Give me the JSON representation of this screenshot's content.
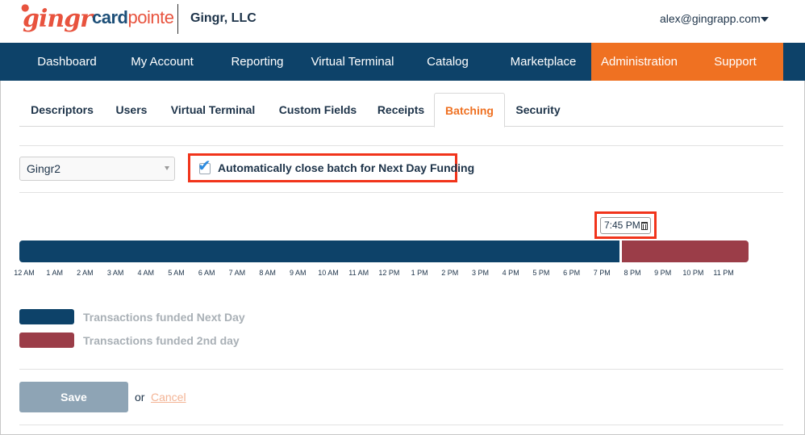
{
  "header": {
    "logo_gingr": "gingr",
    "logo_card": "card",
    "logo_pointe": "pointe",
    "company": "Gingr, LLC",
    "account_email": "alex@gingrapp.com"
  },
  "nav": {
    "items": [
      {
        "label": "Dashboard"
      },
      {
        "label": "My Account"
      },
      {
        "label": "Reporting"
      },
      {
        "label": "Virtual Terminal"
      },
      {
        "label": "Catalog"
      },
      {
        "label": "Marketplace"
      },
      {
        "label": "Administration"
      },
      {
        "label": "Support"
      }
    ],
    "highlight_color": "#ef7122",
    "bg_color": "#0d4269"
  },
  "tabs": {
    "items": [
      {
        "label": "Descriptors"
      },
      {
        "label": "Users"
      },
      {
        "label": "Virtual Terminal"
      },
      {
        "label": "Custom Fields"
      },
      {
        "label": "Receipts"
      },
      {
        "label": "Batching"
      },
      {
        "label": "Security"
      }
    ],
    "active": "Batching"
  },
  "controls": {
    "merchant_select_value": "Gingr2",
    "auto_close_label": "Automatically close batch for Next Day Funding",
    "auto_close_checked": true
  },
  "timeline": {
    "cutoff_time": "7:45 PM",
    "ticks": [
      "12 AM",
      "1 AM",
      "2 AM",
      "3 AM",
      "4 AM",
      "5 AM",
      "6 AM",
      "7 AM",
      "8 AM",
      "9 AM",
      "10 AM",
      "11 AM",
      "12 PM",
      "1 PM",
      "2 PM",
      "3 PM",
      "4 PM",
      "5 PM",
      "6 PM",
      "7 PM",
      "8 PM",
      "9 PM",
      "10 PM",
      "11 PM"
    ],
    "next_day_color": "#0d4269",
    "second_day_color": "#9b3d48"
  },
  "legend": {
    "next_day_label": "Transactions funded Next Day",
    "second_day_label": "Transactions funded 2nd day"
  },
  "actions": {
    "save_label": "Save",
    "or_text": "or",
    "cancel_label": "Cancel"
  },
  "icons": {
    "checkmark": "check-icon",
    "trash": "trash-icon",
    "caret": "chevron-down-icon"
  }
}
